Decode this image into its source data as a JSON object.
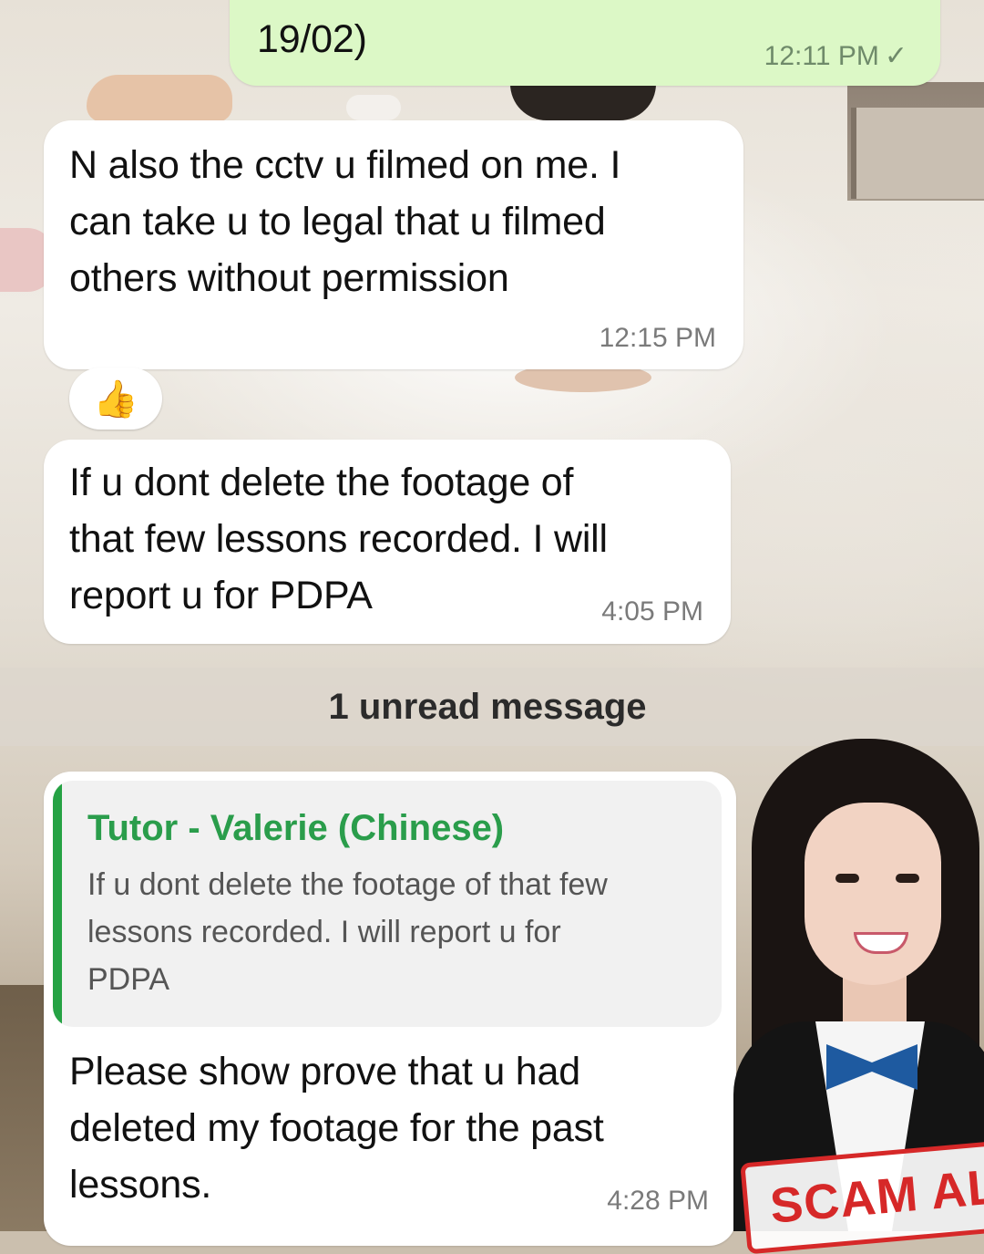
{
  "messages": [
    {
      "direction": "outgoing",
      "text": "19/02)",
      "time": "12:11 PM",
      "status": "sent-check"
    },
    {
      "direction": "incoming",
      "lines": [
        "N also the cctv u filmed on me. I",
        "can take u to legal that u filmed",
        "others without permission"
      ],
      "time": "12:15 PM",
      "reaction": "👍"
    },
    {
      "direction": "incoming",
      "lines": [
        "If u dont delete the footage of",
        "that few lessons recorded. I will",
        "report u for PDPA"
      ],
      "time": "4:05 PM"
    },
    {
      "direction": "incoming",
      "reply_to": {
        "sender": "Tutor - Valerie (Chinese)",
        "lines": [
          "If u dont delete the footage of that few",
          "lessons recorded. I will report u for",
          "PDPA"
        ]
      },
      "lines": [
        "Please show prove that u had",
        "deleted my footage for the past",
        "lessons."
      ],
      "time": "4:28 PM"
    }
  ],
  "unread_divider": "1 unread message",
  "overlay": {
    "stamp_text": "SCAM ALE",
    "stamp_color": "#d62828"
  },
  "colors": {
    "outgoing_bubble": "#dcf8c6",
    "incoming_bubble": "#ffffff",
    "reply_accent": "#25a244"
  },
  "icons": {
    "reaction": "thumbs-up-icon",
    "status": "check-icon"
  }
}
